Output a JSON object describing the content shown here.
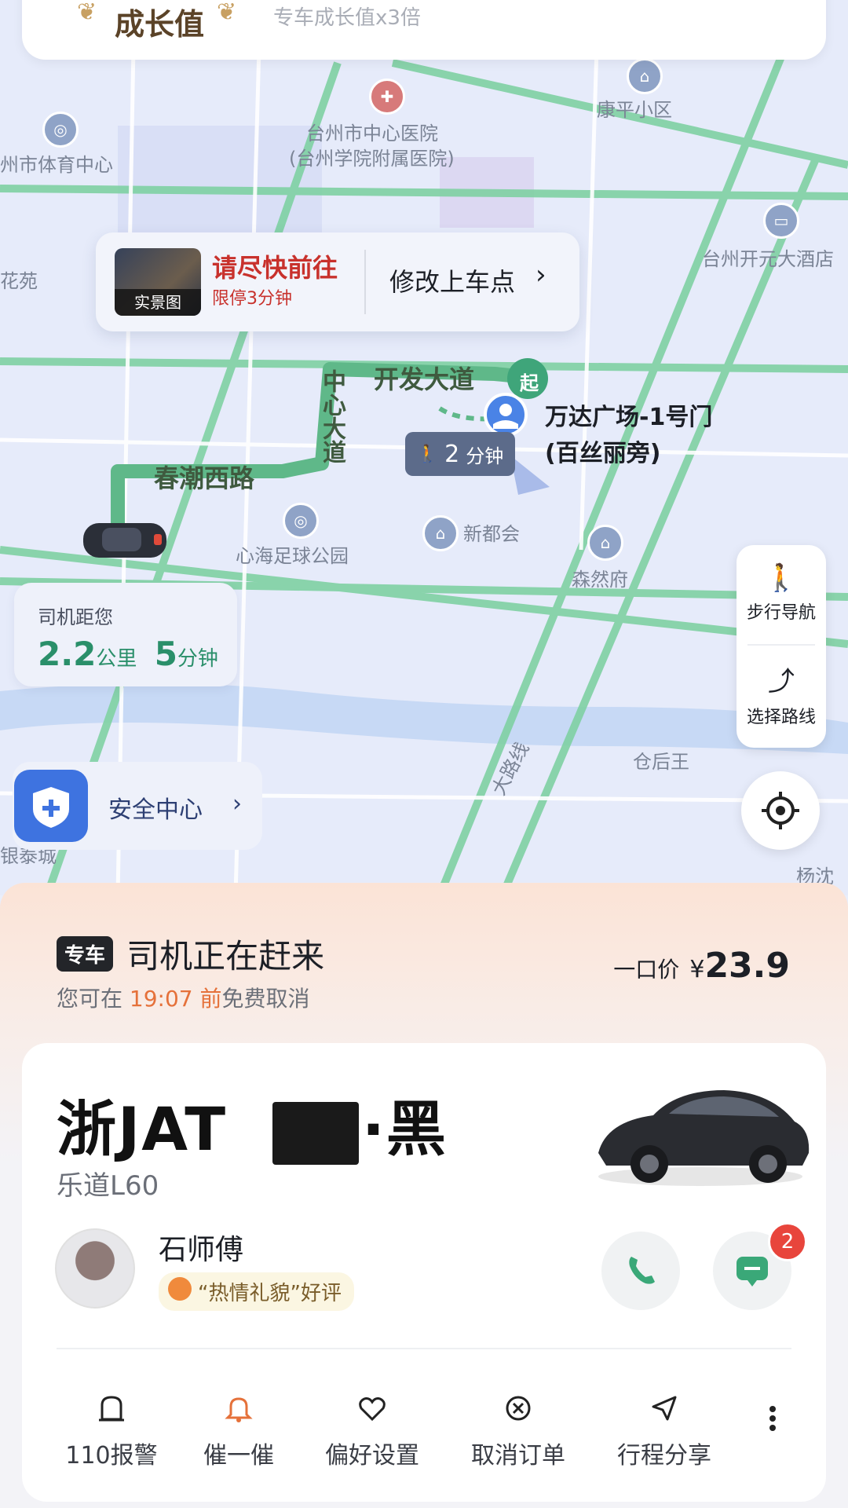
{
  "top_banner": {
    "badge": "成长值",
    "subtitle": "专车成长值x3倍"
  },
  "map": {
    "labels": [
      "台州市中心医院",
      "(台州学院附属医院)",
      "康平小区",
      "州市体育中心",
      "台州开元大酒店",
      "花苑",
      "开发大道",
      "中心大道",
      "春潮西路",
      "新都会",
      "心海足球公园",
      "森然府",
      "仓后王",
      "大路线",
      "杨沈",
      "银泰城"
    ],
    "start_marker": "起",
    "destination": {
      "line1": "万达广场-1号门",
      "line2": "(百丝丽旁)"
    },
    "walk_badge": {
      "num": "2",
      "unit": "分钟"
    }
  },
  "pickup_card": {
    "thumb_label": "实景图",
    "title": "请尽快前往",
    "subtitle": "限停3分钟",
    "edit_label": "修改上车点"
  },
  "driver_distance": {
    "label": "司机距您",
    "km": "2.2",
    "km_unit": "公里",
    "min": "5",
    "min_unit": "分钟"
  },
  "side_panel": {
    "walk_nav": "步行导航",
    "choose_route": "选择路线"
  },
  "safety": {
    "label": "安全中心"
  },
  "order": {
    "tag": "专车",
    "status": "司机正在赶来",
    "cancel_prefix": "您可在 ",
    "cancel_time": "19:07 前",
    "cancel_suffix": "免费取消",
    "price_label": "一口价",
    "currency": "¥",
    "price": "23.9"
  },
  "vehicle": {
    "plate_prefix": "浙JAT",
    "plate_suffix": "·黑",
    "model": "乐道L60"
  },
  "driver": {
    "name": "石师傅",
    "review": "“热情礼貌”好评",
    "unread": "2"
  },
  "actions": [
    {
      "label": "110报警"
    },
    {
      "label": "催一催"
    },
    {
      "label": "偏好设置"
    },
    {
      "label": "取消订单"
    },
    {
      "label": "行程分享"
    }
  ],
  "colors": {
    "accent_green": "#2a8f6a",
    "route_green": "#4caf7d",
    "red": "#c8312c",
    "orange": "#e5713a",
    "blue": "#3e73e0"
  }
}
